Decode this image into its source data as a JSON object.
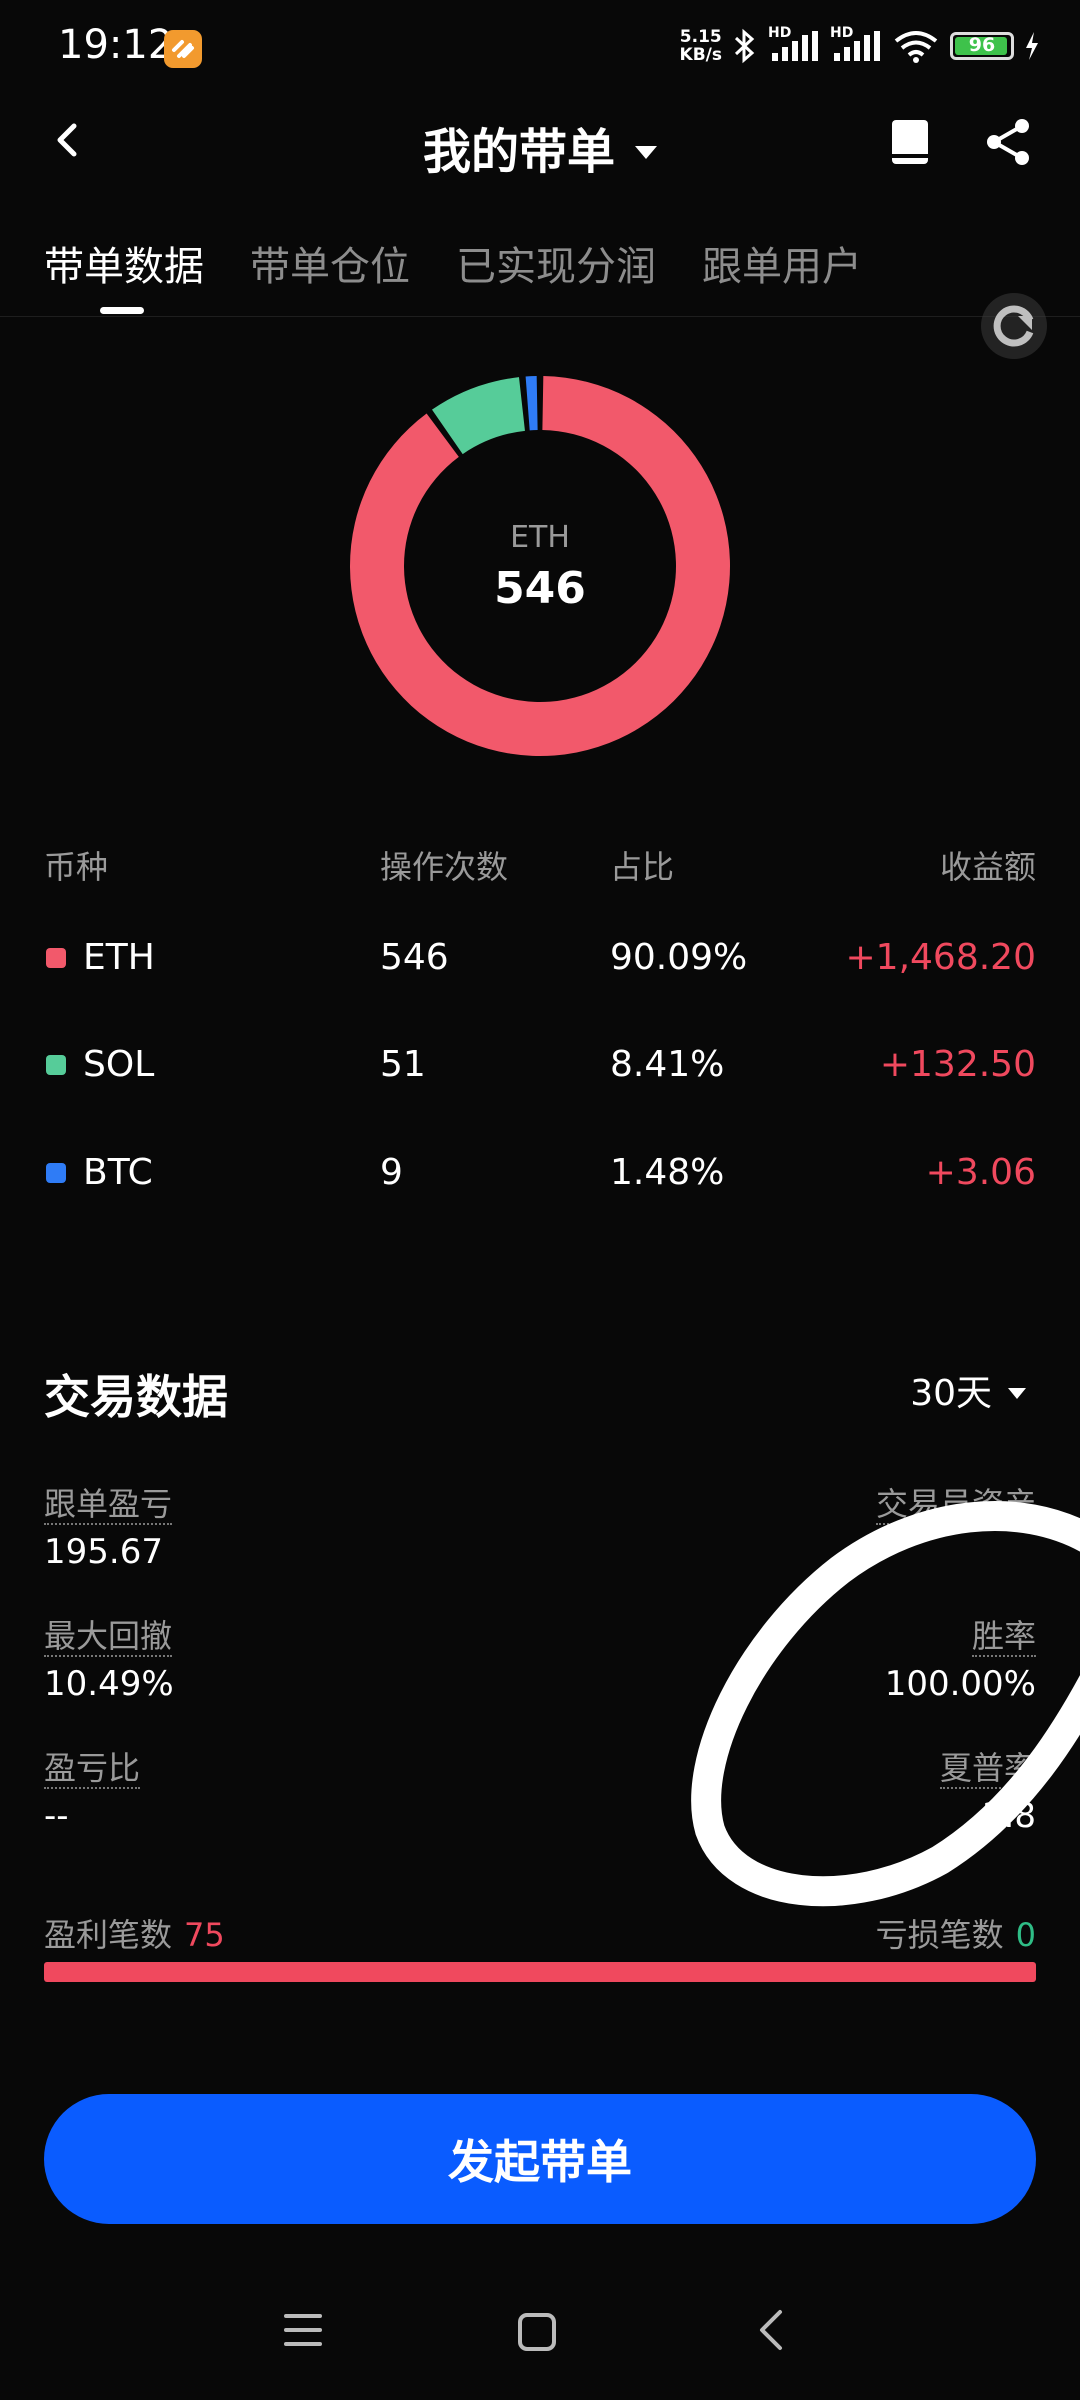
{
  "status_bar": {
    "time": "19:12",
    "net_speed_value": "5.15",
    "net_speed_unit": "KB/s",
    "battery": "96",
    "battery_level": 0.96,
    "hd_label": "HD"
  },
  "header": {
    "title": "我的带单",
    "back_icon": "chevron-left-icon",
    "book_icon": "book-icon",
    "share_icon": "share-icon"
  },
  "tabs": [
    {
      "label": "带单数据",
      "active": true
    },
    {
      "label": "带单仓位",
      "active": false
    },
    {
      "label": "已实现分润",
      "active": false
    },
    {
      "label": "跟单用户",
      "active": false
    }
  ],
  "chart_data": {
    "type": "pie",
    "categories": [
      "ETH",
      "SOL",
      "BTC"
    ],
    "values": [
      546,
      51,
      9
    ],
    "colors": [
      "#f2596b",
      "#56cc99",
      "#2f7cf6"
    ],
    "center_label": "ETH",
    "center_value": "546"
  },
  "table": {
    "headers": [
      "币种",
      "操作次数",
      "占比",
      "收益额"
    ],
    "rows": [
      {
        "symbol": "ETH",
        "ops": "546",
        "pct": "90.09%",
        "pnl": "+1,468.20",
        "color": "#f2596b"
      },
      {
        "symbol": "SOL",
        "ops": "51",
        "pct": "8.41%",
        "pnl": "+132.50",
        "color": "#56cc99"
      },
      {
        "symbol": "BTC",
        "ops": "9",
        "pct": "1.48%",
        "pnl": "+3.06",
        "color": "#2f7cf6"
      }
    ]
  },
  "trade": {
    "title": "交易数据",
    "period": "30天",
    "metrics": {
      "copy_pnl_label": "跟单盈亏",
      "copy_pnl_value": "195.67",
      "trader_assets_label": "交易员资产",
      "max_drawdown_label": "最大回撤",
      "max_drawdown_value": "10.49%",
      "win_rate_label": "胜率",
      "win_rate_value": "100.00%",
      "pl_ratio_label": "盈亏比",
      "pl_ratio_value": "--",
      "sharpe_label": "夏普率",
      "sharpe_value": "3.8"
    },
    "win_count_label": "盈利笔数",
    "win_count": "75",
    "loss_count_label": "亏损笔数",
    "loss_count": "0",
    "win_fraction": 1.0
  },
  "cta": {
    "label": "发起带单"
  },
  "nav": {
    "menu_icon": "menu-icon",
    "home_icon": "home-icon",
    "back_icon": "back-icon"
  }
}
